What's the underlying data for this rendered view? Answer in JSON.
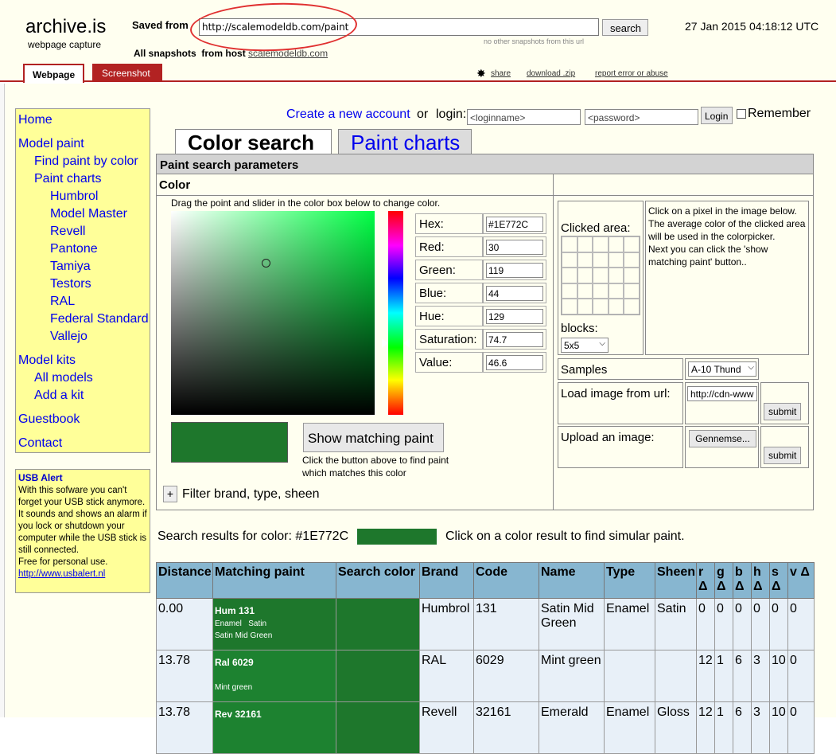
{
  "archive": {
    "logo": "archive.is",
    "subtitle": "webpage capture",
    "saved_from_label": "Saved from",
    "url": "http://scalemodeldb.com/paint",
    "search_label": "search",
    "no_snapshots": "no other snapshots from this url",
    "all_snapshots_label": "All snapshots",
    "from_host_label": "from host",
    "host": "scalemodeldb.com",
    "date": "27 Jan 2015 04:18:12 UTC",
    "tabs": {
      "webpage": "Webpage",
      "screenshot": "Screenshot"
    },
    "links": {
      "share": "share",
      "download": "download .zip",
      "report": "report error or abuse"
    }
  },
  "nav": {
    "home": "Home",
    "model_paint": "Model paint",
    "find_by_color": "Find paint by color",
    "paint_charts": "Paint charts",
    "brands": [
      "Humbrol",
      "Model Master",
      "Revell",
      "Pantone",
      "Tamiya",
      "Testors",
      "RAL",
      "Federal Standard",
      "Vallejo"
    ],
    "model_kits": "Model kits",
    "all_models": "All models",
    "add_kit": "Add a kit",
    "guestbook": "Guestbook",
    "contact": "Contact"
  },
  "usb": {
    "title": "USB Alert",
    "body": "With this sofware you can't forget your USB stick anymore. It sounds and shows an alarm if you lock or shutdown your computer while the USB stick is still connected.",
    "free": "Free for personal use.",
    "link": "http://www.usbalert.nl"
  },
  "login": {
    "create": "Create a new account",
    "or": "or",
    "login_label": "login:",
    "user_placeholder": "<loginname>",
    "pass_placeholder": "<password>",
    "login_btn": "Login",
    "remember": "Remember"
  },
  "tabs": {
    "color_search": "Color search",
    "paint_charts": "Paint charts"
  },
  "panel": {
    "title": "Paint search parameters",
    "color_header": "Color",
    "drag_hint": "Drag the point and slider in the color box below to change color.",
    "fields": [
      {
        "label": "Hex:",
        "value": "#1E772C"
      },
      {
        "label": "Red:",
        "value": "30"
      },
      {
        "label": "Green:",
        "value": "119"
      },
      {
        "label": "Blue:",
        "value": "44"
      },
      {
        "label": "Hue:",
        "value": "129"
      },
      {
        "label": "Saturation:",
        "value": "74.7"
      },
      {
        "label": "Value:",
        "value": "46.6"
      }
    ],
    "selected_color": "#1e772c",
    "show_btn": "Show matching paint",
    "show_hint": "Click the button above to find paint which matches this color",
    "filter_plus": "+",
    "filter_label": "Filter brand, type, sheen",
    "clicked_area": "Clicked area:",
    "blocks_label": "blocks:",
    "blocks_value": "5x5",
    "click_help": "Click on a pixel in the image below.\nThe average color of the clicked area will be used in the colorpicker.\nNext you can click the 'show matching paint' button..",
    "samples_label": "Samples",
    "samples_value": "A-10 Thund",
    "load_url_label": "Load image from url:",
    "load_url_value": "http://cdn-www",
    "upload_label": "Upload an image:",
    "browse_btn": "Gennemse...",
    "submit": "submit"
  },
  "results": {
    "header": "Search results for color: #1E772C",
    "hint": "Click on a color result to find simular paint.",
    "columns": [
      "Distance",
      "Matching paint",
      "Search color",
      "Brand",
      "Code",
      "Name",
      "Type",
      "Sheen",
      "r Δ",
      "g Δ",
      "b Δ",
      "h Δ",
      "s Δ",
      "v Δ"
    ],
    "rows": [
      {
        "distance": "0.00",
        "paint_code": "Hum 131",
        "paint_type": "Enamel",
        "paint_sheen": "Satin",
        "paint_name": "Satin Mid Green",
        "color": "#1e772c",
        "brand": "Humbrol",
        "code": "131",
        "name": "Satin Mid Green",
        "type": "Enamel",
        "sheen": "Satin",
        "r": "0",
        "g": "0",
        "b": "0",
        "h": "0",
        "s": "0",
        "v": "0"
      },
      {
        "distance": "13.78",
        "paint_code": "Ral 6029",
        "paint_type": "",
        "paint_sheen": "",
        "paint_name": "Mint green",
        "color": "#1d8230",
        "brand": "RAL",
        "code": "6029",
        "name": "Mint green",
        "type": "",
        "sheen": "",
        "r": "12",
        "g": "1",
        "b": "6",
        "h": "3",
        "s": "10",
        "v": "0"
      },
      {
        "distance": "13.78",
        "paint_code": "Rev 32161",
        "paint_type": "",
        "paint_sheen": "",
        "paint_name": "",
        "color": "#1d8230",
        "brand": "Revell",
        "code": "32161",
        "name": "Emerald",
        "type": "Enamel",
        "sheen": "Gloss",
        "r": "12",
        "g": "1",
        "b": "6",
        "h": "3",
        "s": "10",
        "v": "0"
      }
    ]
  }
}
